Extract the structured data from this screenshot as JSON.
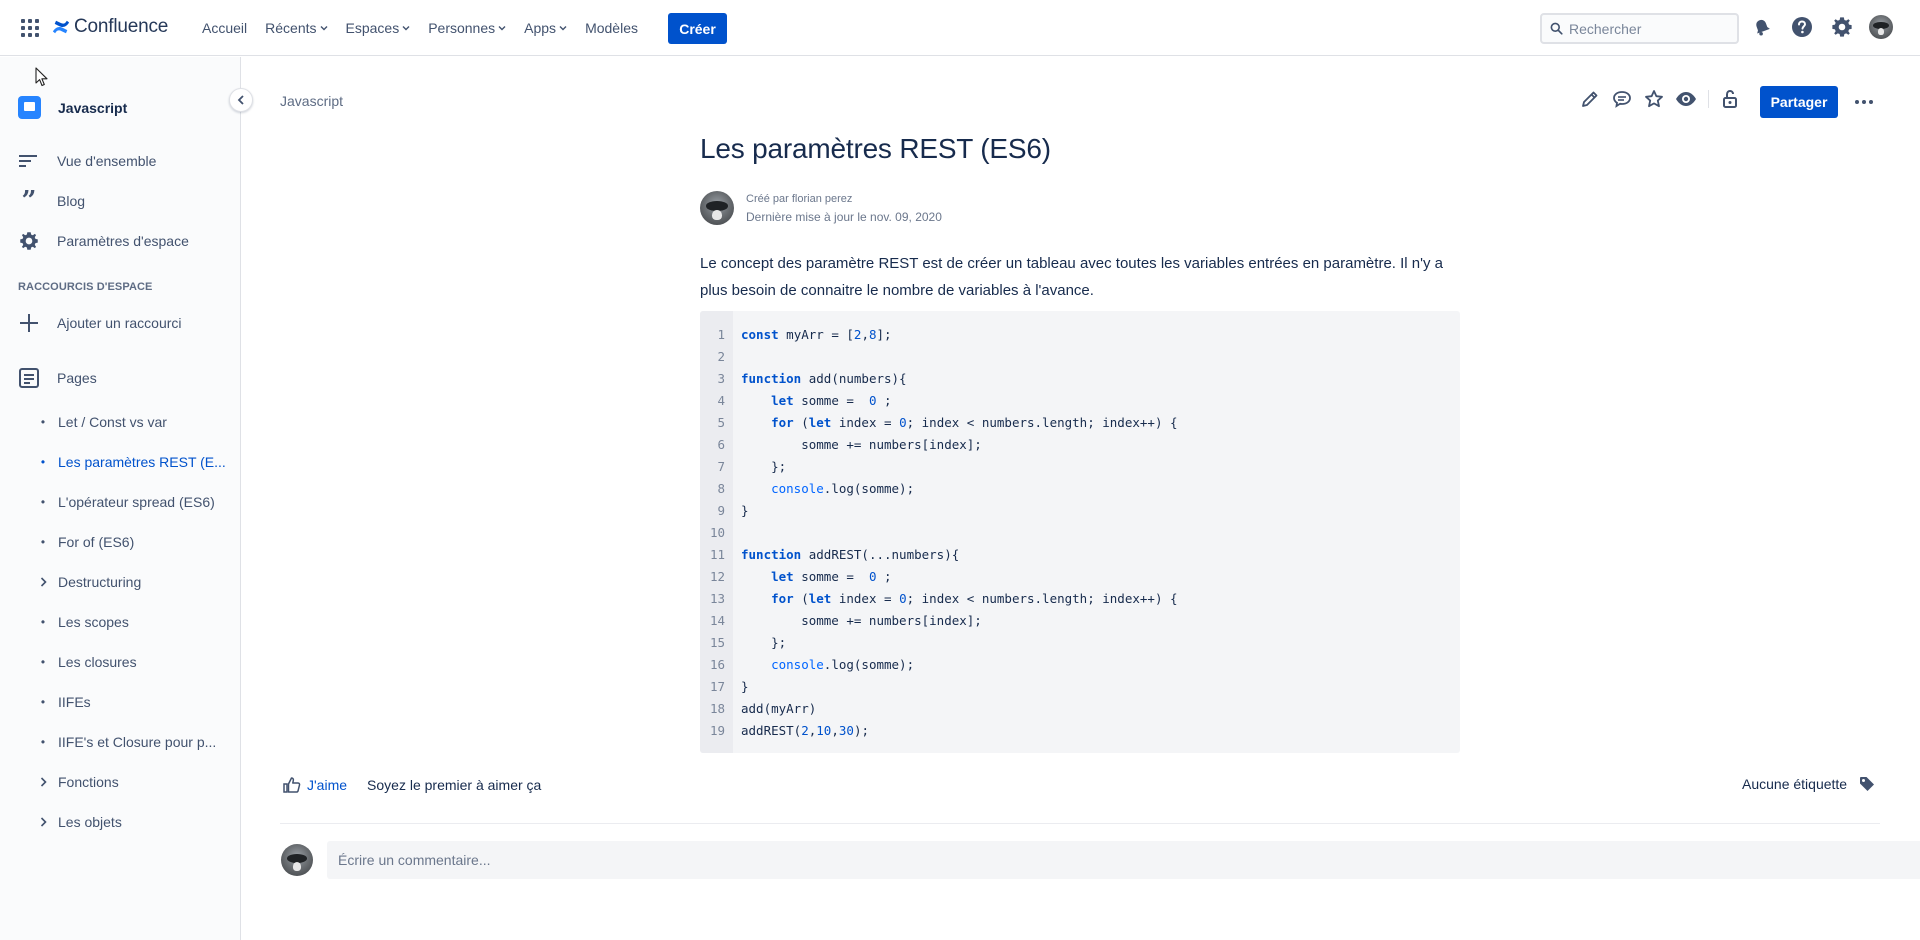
{
  "topnav": {
    "logo_text": "Confluence",
    "items": [
      {
        "label": "Accueil",
        "dropdown": false
      },
      {
        "label": "Récents",
        "dropdown": true
      },
      {
        "label": "Espaces",
        "dropdown": true
      },
      {
        "label": "Personnes",
        "dropdown": true
      },
      {
        "label": "Apps",
        "dropdown": true
      },
      {
        "label": "Modèles",
        "dropdown": false
      }
    ],
    "create_label": "Créer",
    "search_placeholder": "Rechercher",
    "icons": [
      "notifications-icon",
      "help-icon",
      "settings-icon",
      "profile-avatar"
    ]
  },
  "sidebar": {
    "space_name": "Javascript",
    "nav": [
      {
        "label": "Vue d'ensemble",
        "icon": "overview-icon"
      },
      {
        "label": "Blog",
        "icon": "quote-icon"
      },
      {
        "label": "Paramètres d'espace",
        "icon": "gear-icon"
      }
    ],
    "shortcuts_label": "RACCOURCIS D'ESPACE",
    "add_shortcut_label": "Ajouter un raccourci",
    "pages_label": "Pages",
    "pages": [
      {
        "label": "Let / Const vs var",
        "marker": "bullet",
        "active": false
      },
      {
        "label": "Les paramètres REST (E...",
        "marker": "bullet",
        "active": true
      },
      {
        "label": "L'opérateur spread (ES6)",
        "marker": "bullet",
        "active": false
      },
      {
        "label": "For of (ES6)",
        "marker": "bullet",
        "active": false
      },
      {
        "label": "Destructuring",
        "marker": "chevron",
        "active": false
      },
      {
        "label": "Les scopes",
        "marker": "bullet",
        "active": false
      },
      {
        "label": "Les closures",
        "marker": "bullet",
        "active": false
      },
      {
        "label": "IIFEs",
        "marker": "bullet",
        "active": false
      },
      {
        "label": "IIFE's et Closure pour p...",
        "marker": "bullet",
        "active": false
      },
      {
        "label": "Fonctions",
        "marker": "chevron",
        "active": false
      },
      {
        "label": "Les objets",
        "marker": "chevron",
        "active": false
      }
    ]
  },
  "page": {
    "breadcrumb": "Javascript",
    "share_label": "Partager",
    "title": "Les paramètres REST (ES6)",
    "created_by": "Créé par florian perez",
    "last_updated": "Dernière mise à jour le nov. 09, 2020",
    "paragraph": "Le concept des paramètre REST est de créer un tableau avec toutes les variables entrées en paramètre.  Il n'y a plus besoin de connaitre le nombre de variables à l'avance.",
    "code_lines": [
      "const myArr = [2,8];",
      "",
      "function add(numbers){",
      "    let somme =  0 ;",
      "    for (let index = 0; index < numbers.length; index++) {",
      "        somme += numbers[index];",
      "    };",
      "    console.log(somme);",
      "}",
      "",
      "function addREST(...numbers){",
      "    let somme =  0 ;",
      "    for (let index = 0; index < numbers.length; index++) {",
      "        somme += numbers[index];",
      "    };",
      "    console.log(somme);",
      "}",
      "add(myArr)",
      "addREST(2,10,30);"
    ],
    "like_label": "J'aime",
    "like_prompt": "Soyez le premier à aimer ça",
    "labels_text": "Aucune étiquette",
    "comment_placeholder": "Écrire un commentaire..."
  },
  "colors": {
    "primary": "#0052cc",
    "text": "#172b4d",
    "subtle": "#42526e",
    "code_bg": "#f4f5f7"
  }
}
